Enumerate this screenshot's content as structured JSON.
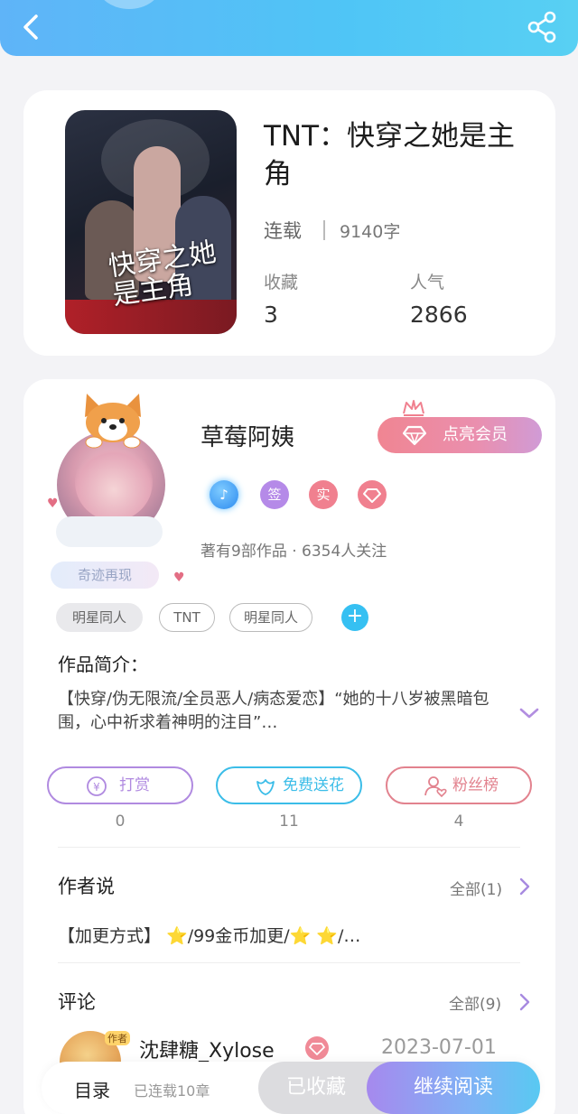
{
  "header": {
    "back_icon": "chevron-left-icon",
    "share_icon": "share-icon",
    "gradient_start": "#5fb4f8",
    "gradient_end": "#58d0f3"
  },
  "book": {
    "title": "TNT：快穿之她是主角",
    "cover_title": "快穿之她是主角",
    "status": "连载",
    "word_count": "9140字",
    "favorites_label": "收藏",
    "favorites_value": "3",
    "popularity_label": "人气",
    "popularity_value": "2866"
  },
  "author": {
    "name": "草莓阿姨",
    "vip_button": "点亮会员",
    "avatar_badge": "奇迹再现",
    "badges": [
      {
        "icon": "music-note-icon",
        "label": "",
        "color": "#2d8bf0"
      },
      {
        "icon": "sign-badge-icon",
        "label": "签",
        "color": "#b58ae8"
      },
      {
        "icon": "verified-badge-icon",
        "label": "实",
        "color": "#f0808f"
      },
      {
        "icon": "diamond-badge-icon",
        "label": "",
        "color": "#f0808f"
      }
    ],
    "works_info": "著有9部作品 · 6354人关注"
  },
  "tags": [
    "明星同人",
    "TNT",
    "明星同人"
  ],
  "intro": {
    "label": "作品简介：",
    "text": "【快穿/伪无限流/全员恶人/病态爱恋】“她的十八岁被黑暗包围，心中祈求着神明的注目”…"
  },
  "actions": [
    {
      "label": "打赏",
      "count": "0",
      "icon": "yen-coin-icon",
      "color": "#b08ae0"
    },
    {
      "label": "免费送花",
      "count": "11",
      "icon": "flower-icon",
      "color": "#3bbde8"
    },
    {
      "label": "粉丝榜",
      "count": "4",
      "icon": "fan-user-icon",
      "color": "#e2828e"
    }
  ],
  "author_say": {
    "title": "作者说",
    "more": "全部(1)",
    "content": "【加更方式】 ⭐/99金币加更/⭐ ⭐/…"
  },
  "comments": {
    "title": "评论",
    "more": "全部(9)",
    "first": {
      "user": "沈肆糖_Xylose",
      "tag": "作者",
      "date": "2023-07-01"
    }
  },
  "bottom": {
    "toc": "目录",
    "toc_sub": "已连载10章",
    "saved": "已收藏",
    "read": "继续阅读"
  }
}
